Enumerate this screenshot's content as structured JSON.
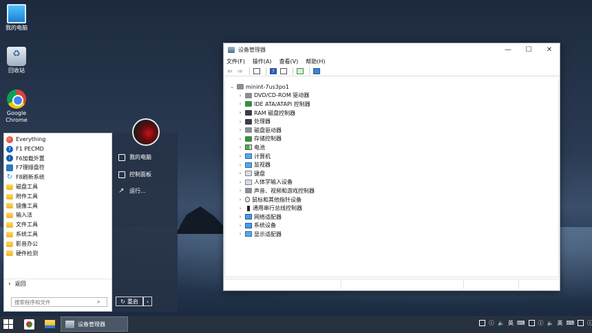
{
  "desktop": {
    "icons": [
      {
        "label": "我的电脑"
      },
      {
        "label": "回收站"
      },
      {
        "label": "Google Chrome"
      }
    ]
  },
  "start_menu": {
    "items": [
      {
        "label": "Everything",
        "icon": "everything-icon"
      },
      {
        "label": "F1 PECMD",
        "icon": "pecmd-icon"
      },
      {
        "label": "F6加载外置",
        "icon": "info-icon"
      },
      {
        "label": "F7理顺盘符",
        "icon": "drive-icon"
      },
      {
        "label": "F8刷新系统",
        "icon": "refresh-icon"
      },
      {
        "label": "磁盘工具",
        "icon": "folder-icon"
      },
      {
        "label": "附件工具",
        "icon": "folder-icon"
      },
      {
        "label": "镜像工具",
        "icon": "folder-icon"
      },
      {
        "label": "输入法",
        "icon": "folder-icon"
      },
      {
        "label": "文件工具",
        "icon": "folder-icon"
      },
      {
        "label": "系统工具",
        "icon": "folder-icon"
      },
      {
        "label": "影音办公",
        "icon": "folder-icon"
      },
      {
        "label": "硬件检测",
        "icon": "folder-icon"
      }
    ],
    "back_label": "返回",
    "search_placeholder": "搜索程序和文件",
    "right": {
      "my_computer": "我的电脑",
      "control_panel": "控制面板",
      "run": "运行..."
    },
    "restart_label": "重启"
  },
  "window": {
    "title": "设备管理器",
    "menu": [
      "文件(F)",
      "操作(A)",
      "查看(V)",
      "帮助(H)"
    ],
    "tree_root": "minint-7us3po1",
    "devices": [
      {
        "label": "DVD/CD-ROM 驱动器",
        "icon": "dvd-drive-icon"
      },
      {
        "label": "IDE ATA/ATAPI 控制器",
        "icon": "ide-controller-icon"
      },
      {
        "label": "RAM 磁盘控制器",
        "icon": "ram-disk-icon"
      },
      {
        "label": "处理器",
        "icon": "processor-icon"
      },
      {
        "label": "磁盘驱动器",
        "icon": "disk-drive-icon"
      },
      {
        "label": "存储控制器",
        "icon": "storage-controller-icon"
      },
      {
        "label": "电池",
        "icon": "battery-icon"
      },
      {
        "label": "计算机",
        "icon": "computer-icon"
      },
      {
        "label": "监视器",
        "icon": "monitor-icon"
      },
      {
        "label": "键盘",
        "icon": "keyboard-icon"
      },
      {
        "label": "人体学输入设备",
        "icon": "hid-icon"
      },
      {
        "label": "声音、视频和游戏控制器",
        "icon": "sound-icon"
      },
      {
        "label": "鼠标和其他指针设备",
        "icon": "mouse-icon"
      },
      {
        "label": "通用串行总线控制器",
        "icon": "usb-icon"
      },
      {
        "label": "网络适配器",
        "icon": "network-adapter-icon"
      },
      {
        "label": "系统设备",
        "icon": "system-device-icon"
      },
      {
        "label": "显示适配器",
        "icon": "display-adapter-icon"
      }
    ]
  },
  "taskbar": {
    "active_app": "设备管理器",
    "ime_label": "英"
  }
}
